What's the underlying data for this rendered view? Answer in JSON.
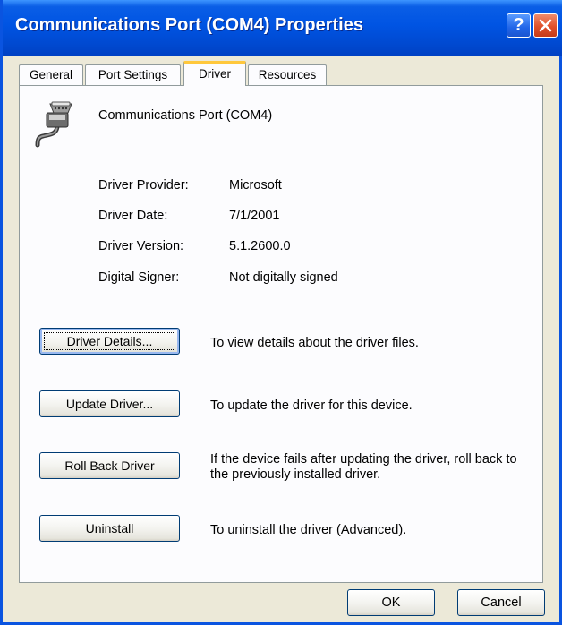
{
  "window": {
    "title": "Communications Port (COM4) Properties",
    "help_label": "?",
    "accent_color": "#0054e3"
  },
  "tabs": [
    {
      "label": "General",
      "active": false
    },
    {
      "label": "Port Settings",
      "active": false
    },
    {
      "label": "Driver",
      "active": true
    },
    {
      "label": "Resources",
      "active": false
    }
  ],
  "device": {
    "icon": "serial-port-icon",
    "name": "Communications Port (COM4)"
  },
  "driver_info": {
    "provider_label": "Driver Provider:",
    "provider_value": "Microsoft",
    "date_label": "Driver Date:",
    "date_value": "7/1/2001",
    "version_label": "Driver Version:",
    "version_value": "5.1.2600.0",
    "signer_label": "Digital Signer:",
    "signer_value": "Not digitally signed"
  },
  "actions": {
    "details_label": "Driver Details...",
    "details_desc": "To view details about the driver files.",
    "update_label": "Update Driver...",
    "update_desc": "To update the driver for this device.",
    "rollback_label": "Roll Back Driver",
    "rollback_desc": "If the device fails after updating the driver, roll back to the previously installed driver.",
    "uninstall_label": "Uninstall",
    "uninstall_desc": "To uninstall the driver (Advanced)."
  },
  "footer": {
    "ok_label": "OK",
    "cancel_label": "Cancel"
  }
}
